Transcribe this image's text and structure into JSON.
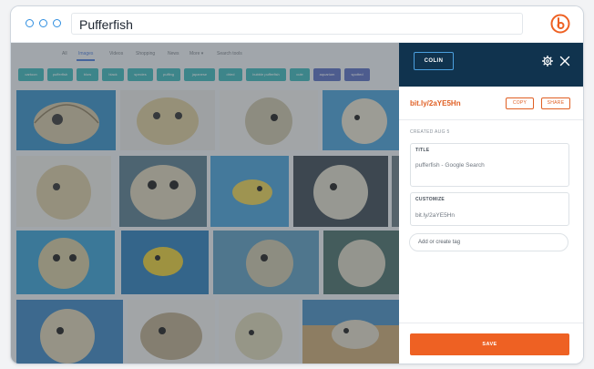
{
  "browser": {
    "url_text": "Pufferfish"
  },
  "search": {
    "nav_tabs": [
      "All",
      "Images",
      "Videos",
      "Shopping",
      "News",
      "More ▾",
      "Search tools"
    ],
    "chips": [
      "cartoon",
      "pufferfish",
      "blow",
      "black",
      "species",
      "puffing",
      "japanese",
      "dried",
      "bubble pufferfish",
      "cute",
      "aquarium",
      "spotted"
    ]
  },
  "panel": {
    "account_label": "COLIN",
    "short_link": "bit.ly/2aYE5Hn",
    "copy_label": "COPY",
    "share_label": "SHARE",
    "created_label": "CREATED AUG 5",
    "title_label": "TITLE",
    "title_value": "pufferfish - Google Search",
    "customize_label": "CUSTOMIZE",
    "customize_value": "bit.ly/2aYE5Hn",
    "tag_placeholder": "Add or create tag",
    "save_label": "SAVE"
  },
  "colors": {
    "panel_header": "#10334e",
    "accent": "#ee6123",
    "link": "#e05f23",
    "chip": "#3fb6b8"
  }
}
